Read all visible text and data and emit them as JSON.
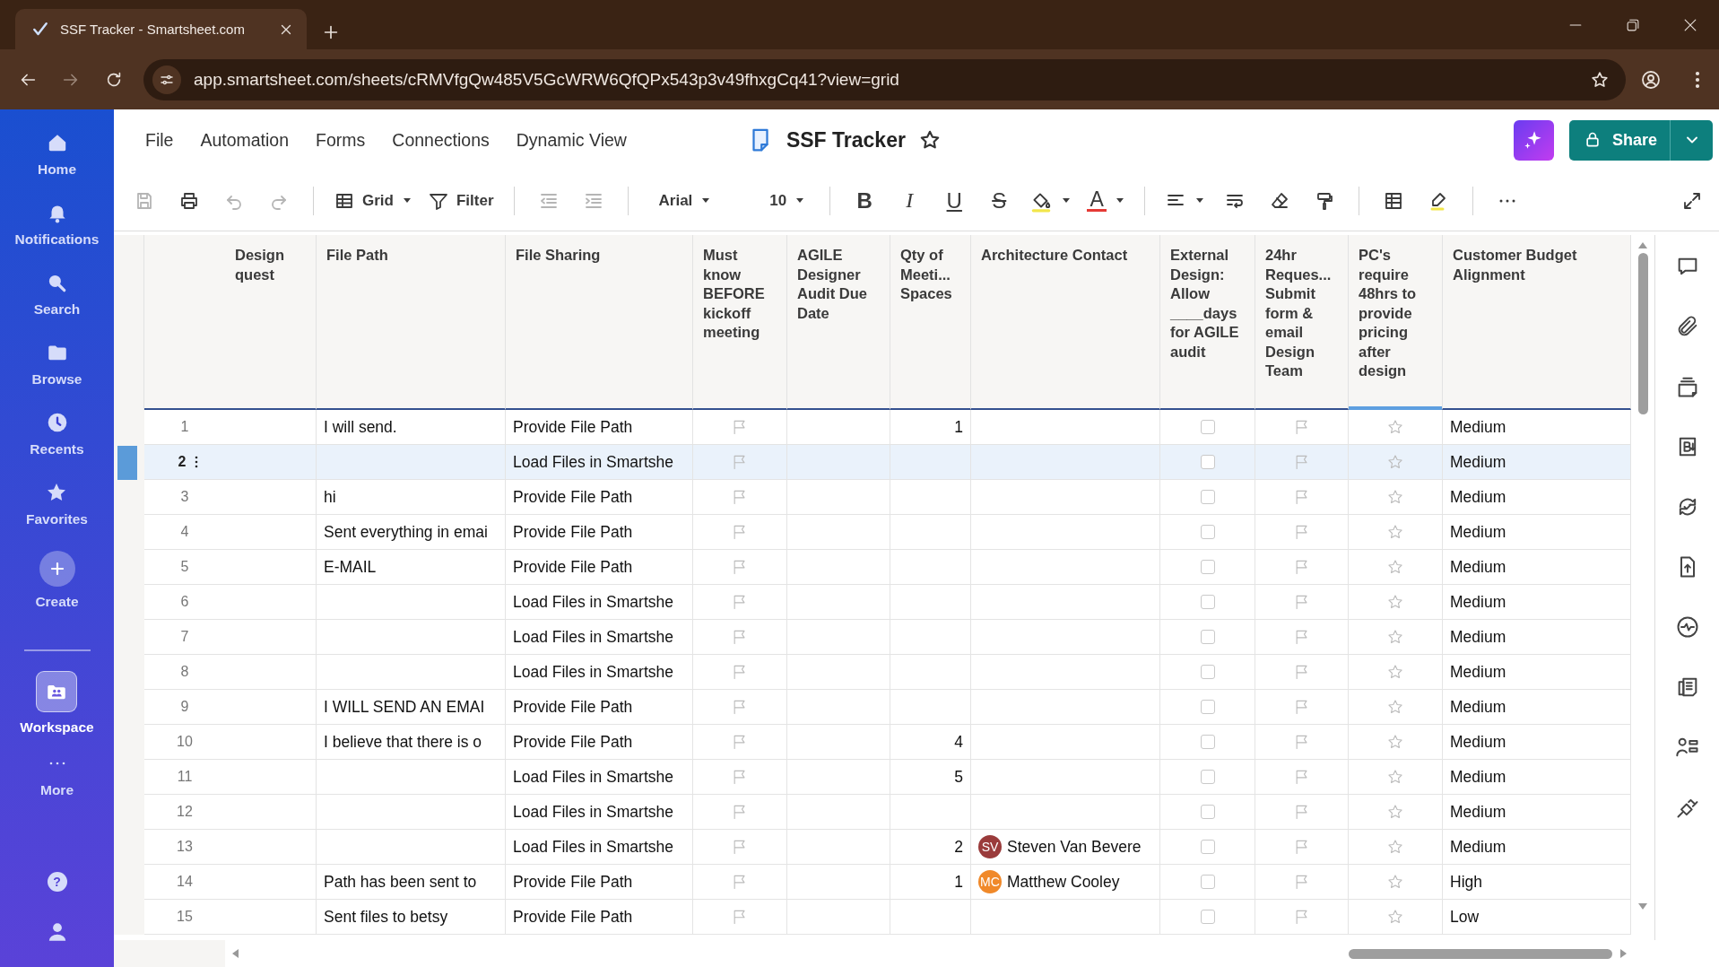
{
  "browser": {
    "tab_title": "SSF Tracker - Smartsheet.com",
    "url": "app.smartsheet.com/sheets/cRMVfgQw485V5GcWRW6QfQPx543p3v49fhxgCq41?view=grid"
  },
  "sidebar": {
    "items": [
      {
        "kind": "home",
        "label": "Home",
        "selected": false
      },
      {
        "kind": "notifications",
        "label": "Notifications",
        "selected": false
      },
      {
        "kind": "search",
        "label": "Search",
        "selected": false
      },
      {
        "kind": "browse",
        "label": "Browse",
        "selected": false
      },
      {
        "kind": "recents",
        "label": "Recents",
        "selected": false
      },
      {
        "kind": "favorites",
        "label": "Favorites",
        "selected": false
      },
      {
        "kind": "create",
        "label": "Create",
        "selected": false
      },
      {
        "kind": "workspace",
        "label": "Workspace",
        "selected": true
      },
      {
        "kind": "more",
        "label": "More",
        "selected": false
      }
    ],
    "help": "?"
  },
  "menu": [
    "File",
    "Automation",
    "Forms",
    "Connections",
    "Dynamic View"
  ],
  "sheet_title": "SSF Tracker",
  "share_label": "Share",
  "toolbar": {
    "save_disabled": true,
    "undo_disabled": true,
    "redo_disabled": true,
    "view_label": "Grid",
    "filter_label": "Filter",
    "outdent_disabled": true,
    "indent_disabled": true,
    "font": "Arial",
    "font_size": "10",
    "bold": "B",
    "italic": "I",
    "underline": "U",
    "strike": "S",
    "text_color": "A"
  },
  "table": {
    "columns": [
      {
        "title": "Design\nquest",
        "highlighted": false
      },
      {
        "title": "File Path",
        "highlighted": false
      },
      {
        "title": "File Sharing",
        "highlighted": false
      },
      {
        "title": "Must know BEFORE kickoff meeting",
        "highlighted": false
      },
      {
        "title": "AGILE Designer Audit Due Date",
        "highlighted": false
      },
      {
        "title": "Qty of\nMeeti...\nSpaces",
        "highlighted": false
      },
      {
        "title": "Architecture Contact",
        "highlighted": false
      },
      {
        "title": "External Design: Allow ____days for AGILE audit",
        "highlighted": false
      },
      {
        "title": "24hr\nReques...\nSubmit form & email Design Team",
        "highlighted": false
      },
      {
        "title": "PC's require 48hrs to provide pricing after design",
        "highlighted": true
      },
      {
        "title": "Customer Budget Alignment",
        "highlighted": false
      }
    ],
    "rows": [
      {
        "number": "1",
        "selected": false,
        "file_path": "I will send.",
        "file_sharing": "Provide File Path",
        "must_know": false,
        "qty": "1",
        "external_design": false,
        "request_24hr": false,
        "pricing": false,
        "budget": "Medium"
      },
      {
        "number": "2",
        "selected": true,
        "file_sharing": "Load Files in Smartshe",
        "must_know": false,
        "external_design": false,
        "request_24hr": false,
        "pricing": false,
        "budget": "Medium"
      },
      {
        "number": "3",
        "selected": false,
        "file_path": "hi",
        "file_sharing": "Provide File Path",
        "must_know": false,
        "external_design": false,
        "request_24hr": false,
        "pricing": false,
        "budget": "Medium"
      },
      {
        "number": "4",
        "selected": false,
        "file_path": "Sent everything in emai",
        "file_sharing": "Provide File Path",
        "must_know": false,
        "external_design": false,
        "request_24hr": false,
        "pricing": false,
        "budget": "Medium"
      },
      {
        "number": "5",
        "selected": false,
        "file_path": "E-MAIL",
        "file_sharing": "Provide File Path",
        "must_know": false,
        "external_design": false,
        "request_24hr": false,
        "pricing": false,
        "budget": "Medium"
      },
      {
        "number": "6",
        "selected": false,
        "file_sharing": "Load Files in Smartshe",
        "must_know": false,
        "external_design": false,
        "request_24hr": false,
        "pricing": false,
        "budget": "Medium"
      },
      {
        "number": "7",
        "selected": false,
        "file_sharing": "Load Files in Smartshe",
        "must_know": false,
        "external_design": false,
        "request_24hr": false,
        "pricing": false,
        "budget": "Medium"
      },
      {
        "number": "8",
        "selected": false,
        "file_sharing": "Load Files in Smartshe",
        "must_know": false,
        "external_design": false,
        "request_24hr": false,
        "pricing": false,
        "budget": "Medium"
      },
      {
        "number": "9",
        "selected": false,
        "file_path": "I WILL SEND AN EMAI",
        "file_sharing": "Provide File Path",
        "must_know": false,
        "external_design": false,
        "request_24hr": false,
        "pricing": false,
        "budget": "Medium"
      },
      {
        "number": "10",
        "selected": false,
        "file_path": "I believe that there is o",
        "file_sharing": "Provide File Path",
        "must_know": false,
        "qty": "4",
        "external_design": false,
        "request_24hr": false,
        "pricing": false,
        "budget": "Medium"
      },
      {
        "number": "11",
        "selected": false,
        "file_sharing": "Load Files in Smartshe",
        "must_know": false,
        "qty": "5",
        "external_design": false,
        "request_24hr": false,
        "pricing": false,
        "budget": "Medium"
      },
      {
        "number": "12",
        "selected": false,
        "file_sharing": "Load Files in Smartshe",
        "must_know": false,
        "external_design": false,
        "request_24hr": false,
        "pricing": false,
        "budget": "Medium"
      },
      {
        "number": "13",
        "selected": false,
        "file_sharing": "Load Files in Smartshe",
        "must_know": false,
        "qty": "2",
        "contact": {
          "initials": "SV",
          "name": "Steven Van Bevere",
          "color": "#9a3b3b"
        },
        "external_design": false,
        "request_24hr": false,
        "pricing": false,
        "budget": "Medium"
      },
      {
        "number": "14",
        "selected": false,
        "file_path": "Path has been sent to",
        "file_sharing": "Provide File Path",
        "must_know": false,
        "qty": "1",
        "contact": {
          "initials": "MC",
          "name": "Matthew Cooley",
          "color": "#f0892a"
        },
        "external_design": false,
        "request_24hr": false,
        "pricing": false,
        "budget": "High"
      },
      {
        "number": "15",
        "selected": false,
        "file_path": "Sent files to betsy",
        "file_sharing": "Provide File Path",
        "must_know": false,
        "external_design": false,
        "request_24hr": false,
        "pricing": false,
        "budget": "Low"
      }
    ]
  }
}
